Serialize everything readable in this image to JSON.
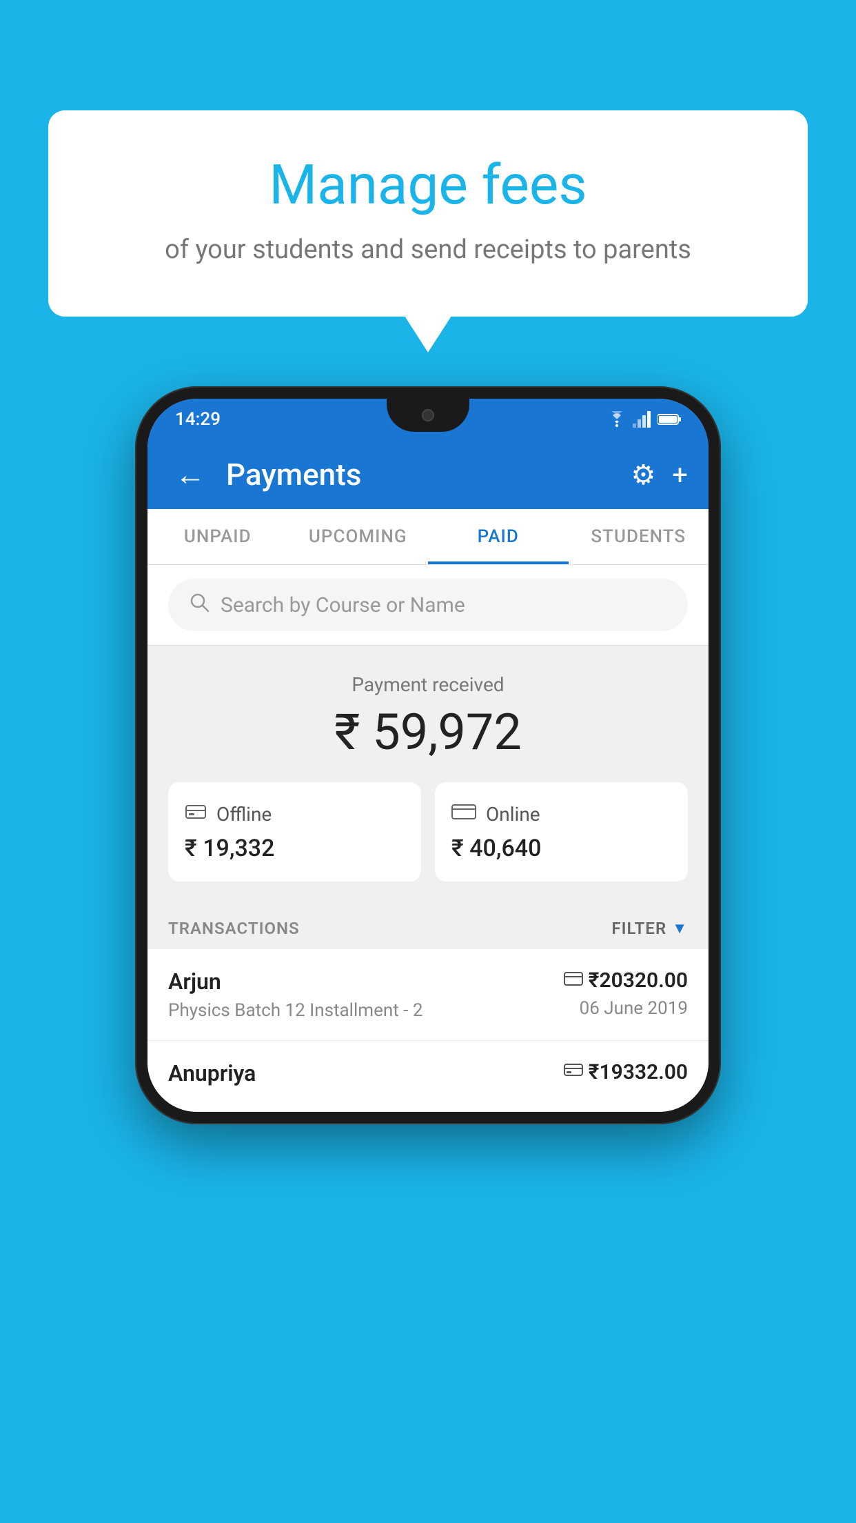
{
  "background_color": "#1ab4e8",
  "bubble": {
    "title": "Manage fees",
    "subtitle": "of your students and send receipts to parents"
  },
  "status_bar": {
    "time": "14:29",
    "wifi": "▾",
    "signal": "▾",
    "battery": "▮"
  },
  "app_bar": {
    "title": "Payments",
    "back_label": "←",
    "settings_label": "⚙",
    "add_label": "+"
  },
  "tabs": [
    {
      "label": "UNPAID",
      "active": false
    },
    {
      "label": "UPCOMING",
      "active": false
    },
    {
      "label": "PAID",
      "active": true
    },
    {
      "label": "STUDENTS",
      "active": false
    }
  ],
  "search": {
    "placeholder": "Search by Course or Name"
  },
  "payment_summary": {
    "label": "Payment received",
    "total": "₹ 59,972",
    "offline_label": "Offline",
    "offline_amount": "₹ 19,332",
    "online_label": "Online",
    "online_amount": "₹ 40,640"
  },
  "transactions": {
    "section_label": "TRANSACTIONS",
    "filter_label": "FILTER",
    "rows": [
      {
        "name": "Arjun",
        "detail": "Physics Batch 12 Installment - 2",
        "amount": "₹20320.00",
        "date": "06 June 2019",
        "payment_type": "online"
      },
      {
        "name": "Anupriya",
        "detail": "",
        "amount": "₹19332.00",
        "date": "",
        "payment_type": "offline"
      }
    ]
  }
}
